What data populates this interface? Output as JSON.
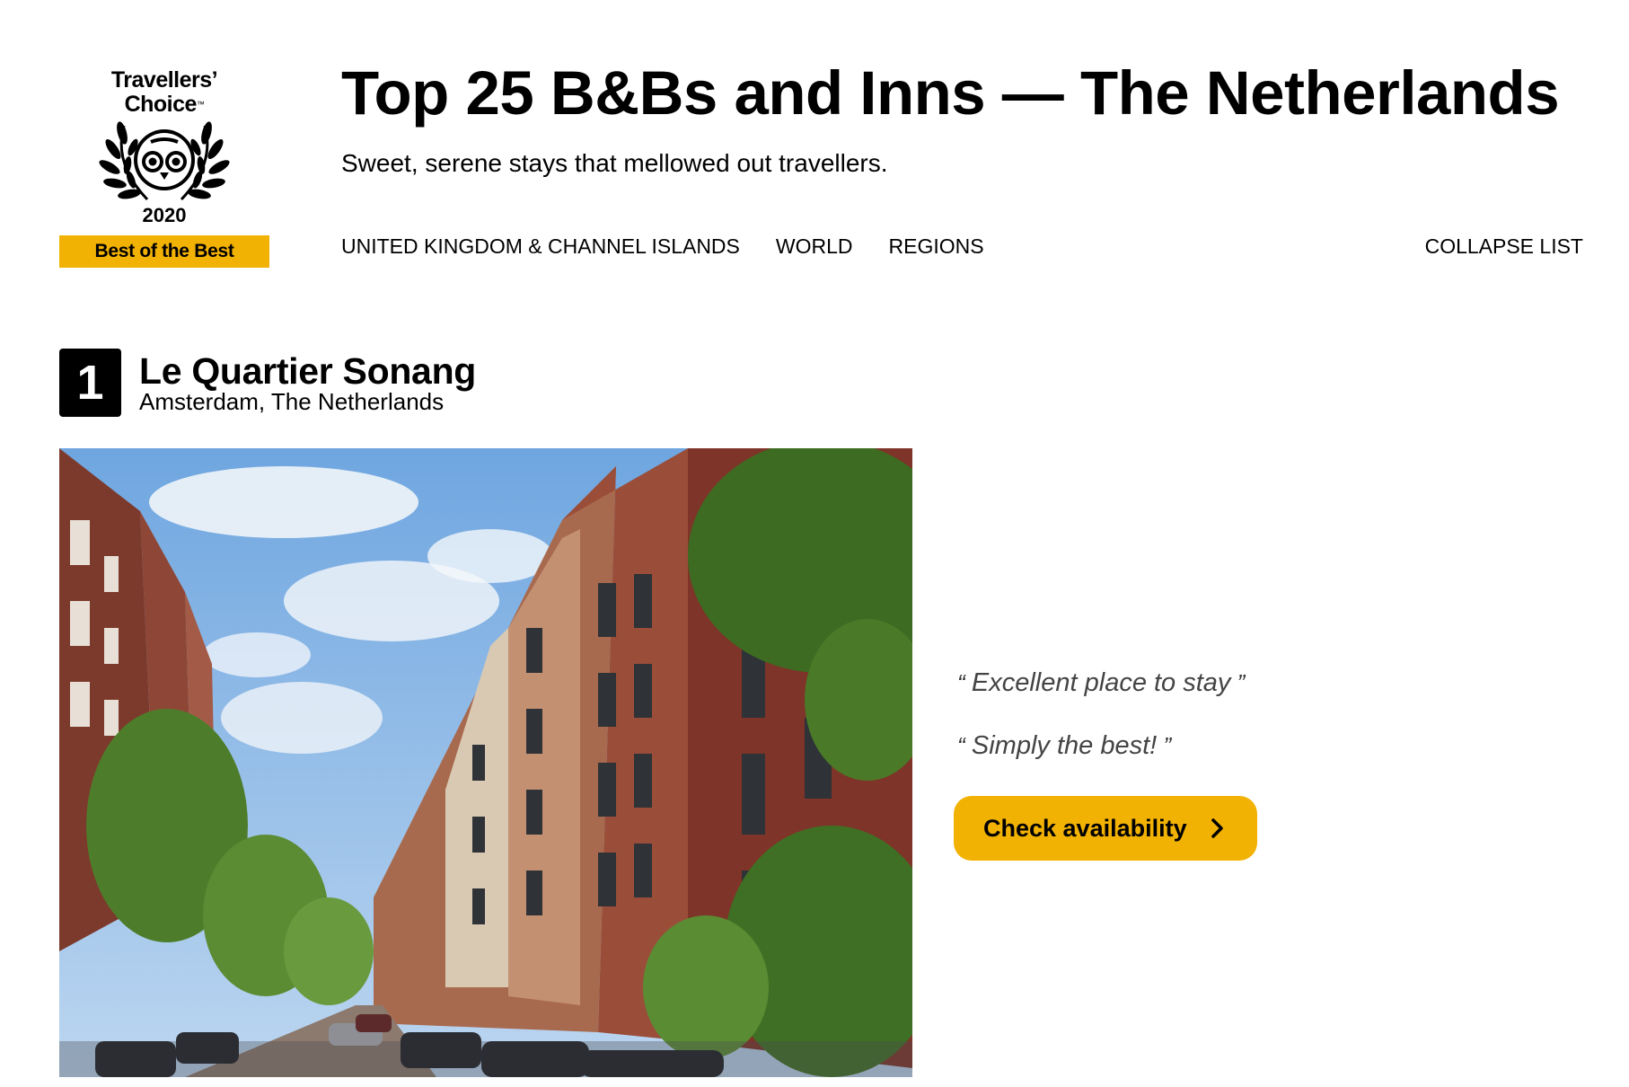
{
  "badge": {
    "line1": "Travellers’",
    "line2": "Choice",
    "tm": "™",
    "year": "2020",
    "ribbon": "Best of the Best"
  },
  "header": {
    "title": "Top 25 B&Bs and Inns — The Netherlands",
    "subtitle": "Sweet, serene stays that mellowed out travellers."
  },
  "nav": {
    "links": [
      "UNITED KINGDOM & CHANNEL ISLANDS",
      "WORLD",
      "REGIONS"
    ],
    "collapse": "COLLAPSE LIST"
  },
  "listing": {
    "rank": "1",
    "name": "Le Quartier Sonang",
    "location": "Amsterdam, The Netherlands",
    "quotes": [
      "Excellent place to stay",
      "Simply the best!"
    ],
    "cta_label": "Check availability"
  },
  "colors": {
    "accent": "#f2b203",
    "text": "#000000",
    "quote_text": "#444444"
  },
  "icons": {
    "emblem": "owl-laurel-icon",
    "cta": "chevron-right-icon"
  }
}
